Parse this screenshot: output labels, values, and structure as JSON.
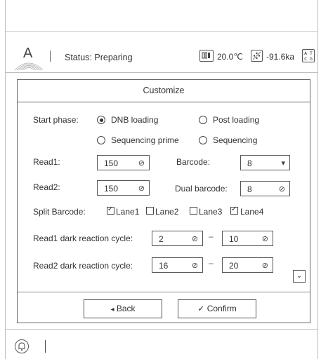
{
  "status_bar": {
    "logo_letter": "A",
    "status_text": "Status: Preparing",
    "temperature": "20.0℃",
    "pressure": "-91.6ka",
    "atcg_icon": {
      "top": "A T",
      "bottom": "C G"
    }
  },
  "dialog": {
    "title": "Customize",
    "start_phase": {
      "label": "Start phase:",
      "options": [
        "DNB loading",
        "Post loading",
        "Sequencing prime",
        "Sequencing"
      ],
      "selected": "DNB loading"
    },
    "read1": {
      "label": "Read1:",
      "value": "150"
    },
    "barcode": {
      "label": "Barcode:",
      "value": "8"
    },
    "read2": {
      "label": "Read2:",
      "value": "150"
    },
    "dual_barcode": {
      "label": "Dual barcode:",
      "value": "8"
    },
    "split_barcode": {
      "label": "Split Barcode:",
      "lanes": [
        {
          "label": "Lane1",
          "checked": true
        },
        {
          "label": "Lane2",
          "checked": false
        },
        {
          "label": "Lane3",
          "checked": false
        },
        {
          "label": "Lane4",
          "checked": true
        }
      ]
    },
    "read1_dark": {
      "label": "Read1 dark reaction cycle:",
      "from": "2",
      "to": "10"
    },
    "read2_dark": {
      "label": "Read2 dark reaction cycle:",
      "from": "16",
      "to": "20"
    },
    "range_separator": "–",
    "back_label": "Back",
    "confirm_label": "Confirm"
  },
  "icons": {
    "stepper": "⊘",
    "dropdown": "▾",
    "back_arrow": "◂",
    "confirm_check": "✓",
    "check_tick": "✓",
    "scroll_down": "⌄",
    "bell": "🔔"
  }
}
